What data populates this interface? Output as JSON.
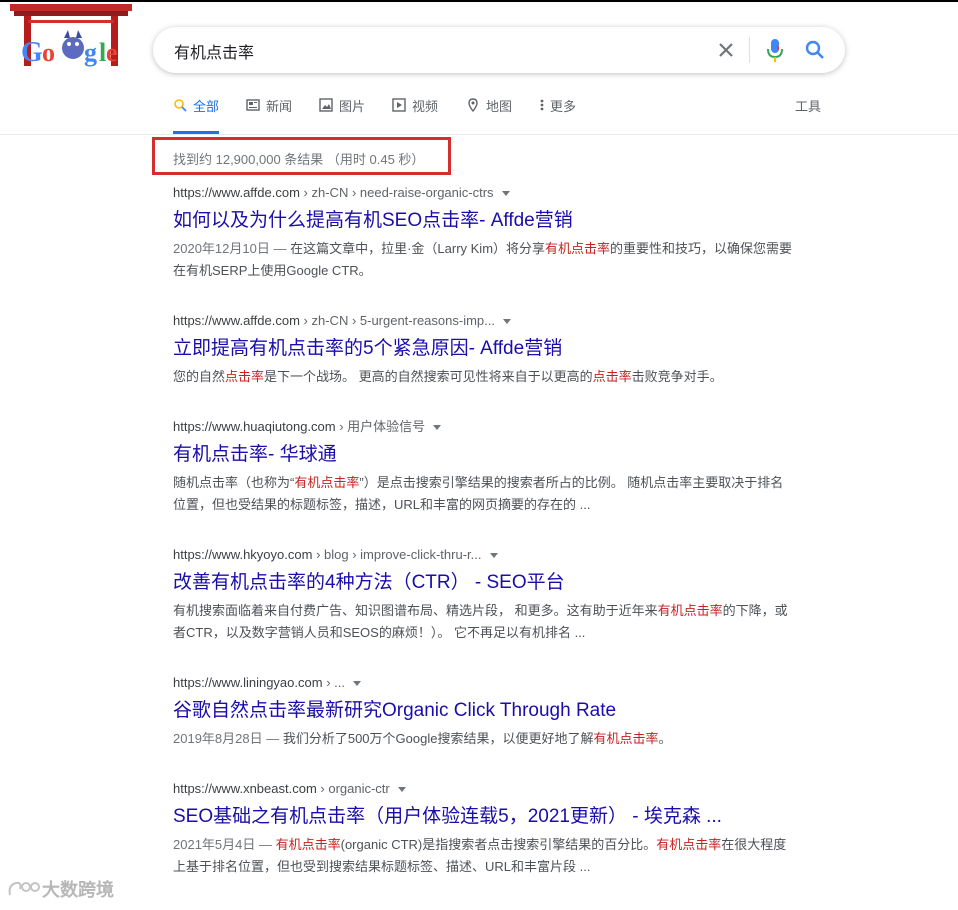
{
  "search": {
    "query": "有机点击率"
  },
  "tabs": [
    {
      "label": "全部",
      "icon": "search-icon",
      "active": true
    },
    {
      "label": "新闻",
      "icon": "news-icon"
    },
    {
      "label": "图片",
      "icon": "image-icon"
    },
    {
      "label": "视频",
      "icon": "video-icon"
    },
    {
      "label": "地图",
      "icon": "map-pin-icon"
    },
    {
      "label": "更多",
      "icon": "more-vert-icon"
    }
  ],
  "tools_label": "工具",
  "stats": "找到约 12,900,000 条结果 （用时 0.45 秒）",
  "colors": {
    "link": "#1a0dab",
    "highlight": "#c5221f",
    "accent": "#1a73e8",
    "box": "#d32f2f"
  },
  "results": [
    {
      "domain": "https://www.affde.com",
      "path": " › zh-CN › need-raise-organic-ctrs",
      "title": "如何以及为什么提高有机SEO点击率- Affde营销",
      "date": "2020年12月10日 — ",
      "s1": "在这篇文章中，拉里·金（Larry Kim）将分享",
      "h1": "有机点击率",
      "s2": "的重要性和技巧，以确保您需要在有机SERP上使用Google CTR。"
    },
    {
      "domain": "https://www.affde.com",
      "path": " › zh-CN › 5-urgent-reasons-imp...",
      "title": "立即提高有机点击率的5个紧急原因- Affde营销",
      "s1": "您的自然",
      "h1": "点击率",
      "s2": "是下一个战场。 更高的自然搜索可见性将来自于以更高的",
      "h2": "点击率",
      "s3": "击败竞争对手。"
    },
    {
      "domain": "https://www.huaqiutong.com",
      "path": " › 用户体验信号",
      "title": "有机点击率- 华球通",
      "s1": "随机点击率（也称为“",
      "h1": "有机点击率",
      "s2": "”）是点击搜索引擎结果的搜索者所占的比例。 随机点击率主要取决于排名位置，但也受结果的标题标签，描述，URL和丰富的网页摘要的存在的 ..."
    },
    {
      "domain": "https://www.hkyoyo.com",
      "path": " › blog › improve-click-thru-r...",
      "title": "改善有机点击率的4种方法（CTR） - SEO平台",
      "s1": "有机搜索面临着来自付费广告、知识图谱布局、精选片段， 和更多。这有助于近年来",
      "h1": "有机点击率",
      "s2": "的下降，或者CTR，以及数字营销人员和SEOS的麻烦！）。 它不再足以有机排名 ..."
    },
    {
      "domain": "https://www.liningyao.com",
      "path": " › ...",
      "title": "谷歌自然点击率最新研究Organic Click Through Rate",
      "date": "2019年8月28日 — ",
      "s1": "我们分析了500万个Google搜索结果，以便更好地了解",
      "h1": "有机点击率",
      "s2": "。"
    },
    {
      "domain": "https://www.xnbeast.com",
      "path": " › organic-ctr",
      "title": "SEO基础之有机点击率（用户体验连载5，2021更新） - 埃克森 ...",
      "date": "2021年5月4日 — ",
      "s1": "",
      "h1": "有机点击率",
      "s2": "(organic CTR)是指搜索者点击搜索引擎结果的百分比。",
      "h2": "有机点击率",
      "s3": "在很大程度上基于排名位置，但也受到搜索结果标题标签、描述、URL和丰富片段 ..."
    }
  ],
  "watermark": "大数跨境"
}
